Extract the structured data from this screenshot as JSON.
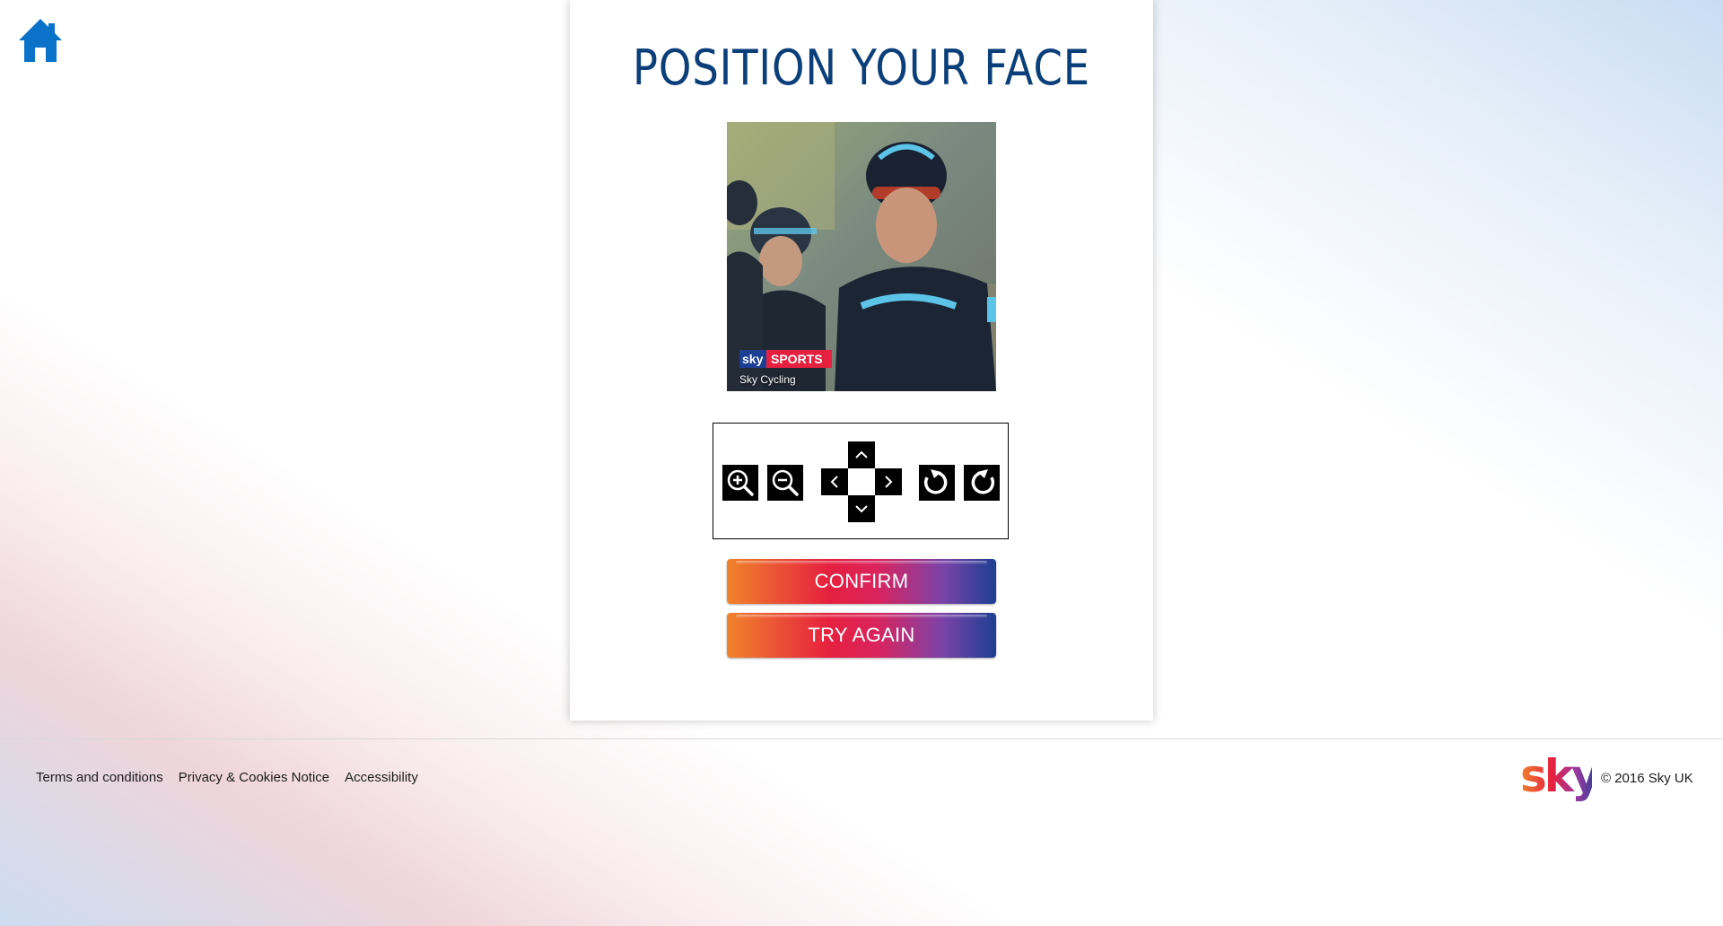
{
  "page": {
    "title": "POSITION YOUR FACE",
    "home_icon": "home-icon",
    "accent_color": "#0b3f7a",
    "home_color": "#0a73c9"
  },
  "photo": {
    "watermark_logo_text": "sky SPORTS",
    "watermark_caption": "Sky Cycling"
  },
  "controls": [
    {
      "name": "zoom-in-button",
      "icon": "zoom-in-icon"
    },
    {
      "name": "zoom-out-button",
      "icon": "zoom-out-icon"
    },
    {
      "name": "move-up-button",
      "icon": "chevron-up-icon"
    },
    {
      "name": "move-left-button",
      "icon": "chevron-left-icon"
    },
    {
      "name": "move-right-button",
      "icon": "chevron-right-icon"
    },
    {
      "name": "move-down-button",
      "icon": "chevron-down-icon"
    },
    {
      "name": "rotate-left-button",
      "icon": "rotate-left-icon"
    },
    {
      "name": "rotate-right-button",
      "icon": "rotate-right-icon"
    }
  ],
  "actions": {
    "confirm_label": "CONFIRM",
    "try_again_label": "TRY AGAIN"
  },
  "footer": {
    "links": [
      "Terms and conditions",
      "Privacy & Cookies Notice",
      "Accessibility"
    ],
    "logo_text": "sky",
    "copyright": "© 2016 Sky UK"
  }
}
